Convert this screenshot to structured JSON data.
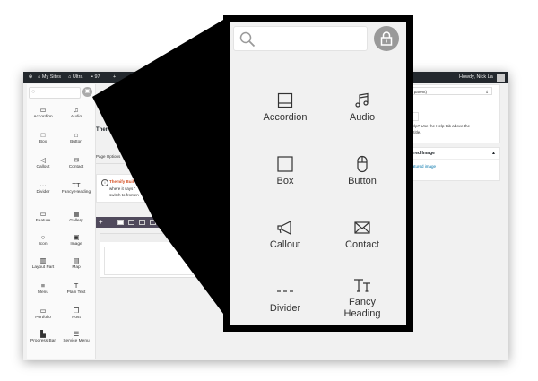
{
  "admin_bar": {
    "site_label": "My Sites",
    "theme_label": "Ultra",
    "comments_count": "97",
    "howdy": "Howdy, Nick La"
  },
  "small_panel": {
    "items": [
      {
        "label": "Accordion",
        "icon": "accordion-icon"
      },
      {
        "label": "Audio",
        "icon": "audio-icon"
      },
      {
        "label": "Box",
        "icon": "box-icon"
      },
      {
        "label": "Button",
        "icon": "button-icon"
      },
      {
        "label": "Callout",
        "icon": "callout-icon"
      },
      {
        "label": "Contact",
        "icon": "contact-icon"
      },
      {
        "label": "Divider",
        "icon": "divider-icon"
      },
      {
        "label": "Fancy Heading",
        "icon": "fancy-heading-icon"
      },
      {
        "label": "Feature",
        "icon": "feature-icon"
      },
      {
        "label": "Gallery",
        "icon": "gallery-icon"
      },
      {
        "label": "Icon",
        "icon": "icon-icon"
      },
      {
        "label": "Image",
        "icon": "image-icon"
      },
      {
        "label": "Layout Part",
        "icon": "layout-part-icon"
      },
      {
        "label": "Map",
        "icon": "map-icon"
      },
      {
        "label": "Menu",
        "icon": "menu-icon"
      },
      {
        "label": "Plain Text",
        "icon": "plain-text-icon"
      },
      {
        "label": "Portfolio",
        "icon": "portfolio-icon"
      },
      {
        "label": "Post",
        "icon": "post-icon"
      },
      {
        "label": "Progress Bar",
        "icon": "progress-bar-icon"
      },
      {
        "label": "Service Menu",
        "icon": "service-menu-icon"
      }
    ]
  },
  "editor": {
    "title": "Themify Cu",
    "page_options_tab": "Page Options",
    "notice_title": "Themify Buil",
    "notice_line2": "where it says \"",
    "notice_line3": "switch to fronten"
  },
  "right_sidebar": {
    "parent_select": "(no parent)",
    "order_label": "rder",
    "help_text_1": "ed help? Use the Help tab above the",
    "help_text_2": "reen title.",
    "featured_image_title": "eatured Image",
    "featured_image_link": "et featured image"
  },
  "zoom_panel": {
    "items": [
      {
        "label": "Accordion",
        "icon": "accordion-icon"
      },
      {
        "label": "Audio",
        "icon": "audio-icon"
      },
      {
        "label": "Box",
        "icon": "box-icon"
      },
      {
        "label": "Button",
        "icon": "button-icon"
      },
      {
        "label": "Callout",
        "icon": "callout-icon"
      },
      {
        "label": "Contact",
        "icon": "contact-icon"
      },
      {
        "label": "Divider",
        "icon": "divider-icon"
      },
      {
        "label": "Fancy Heading",
        "icon": "fancy-heading-icon"
      }
    ]
  },
  "colors": {
    "admin_bar_bg": "#23282d",
    "builder_bar_bg": "#504a5c",
    "notice_accent": "#d54e21",
    "link": "#0073aa",
    "lock_bg": "#999999"
  }
}
